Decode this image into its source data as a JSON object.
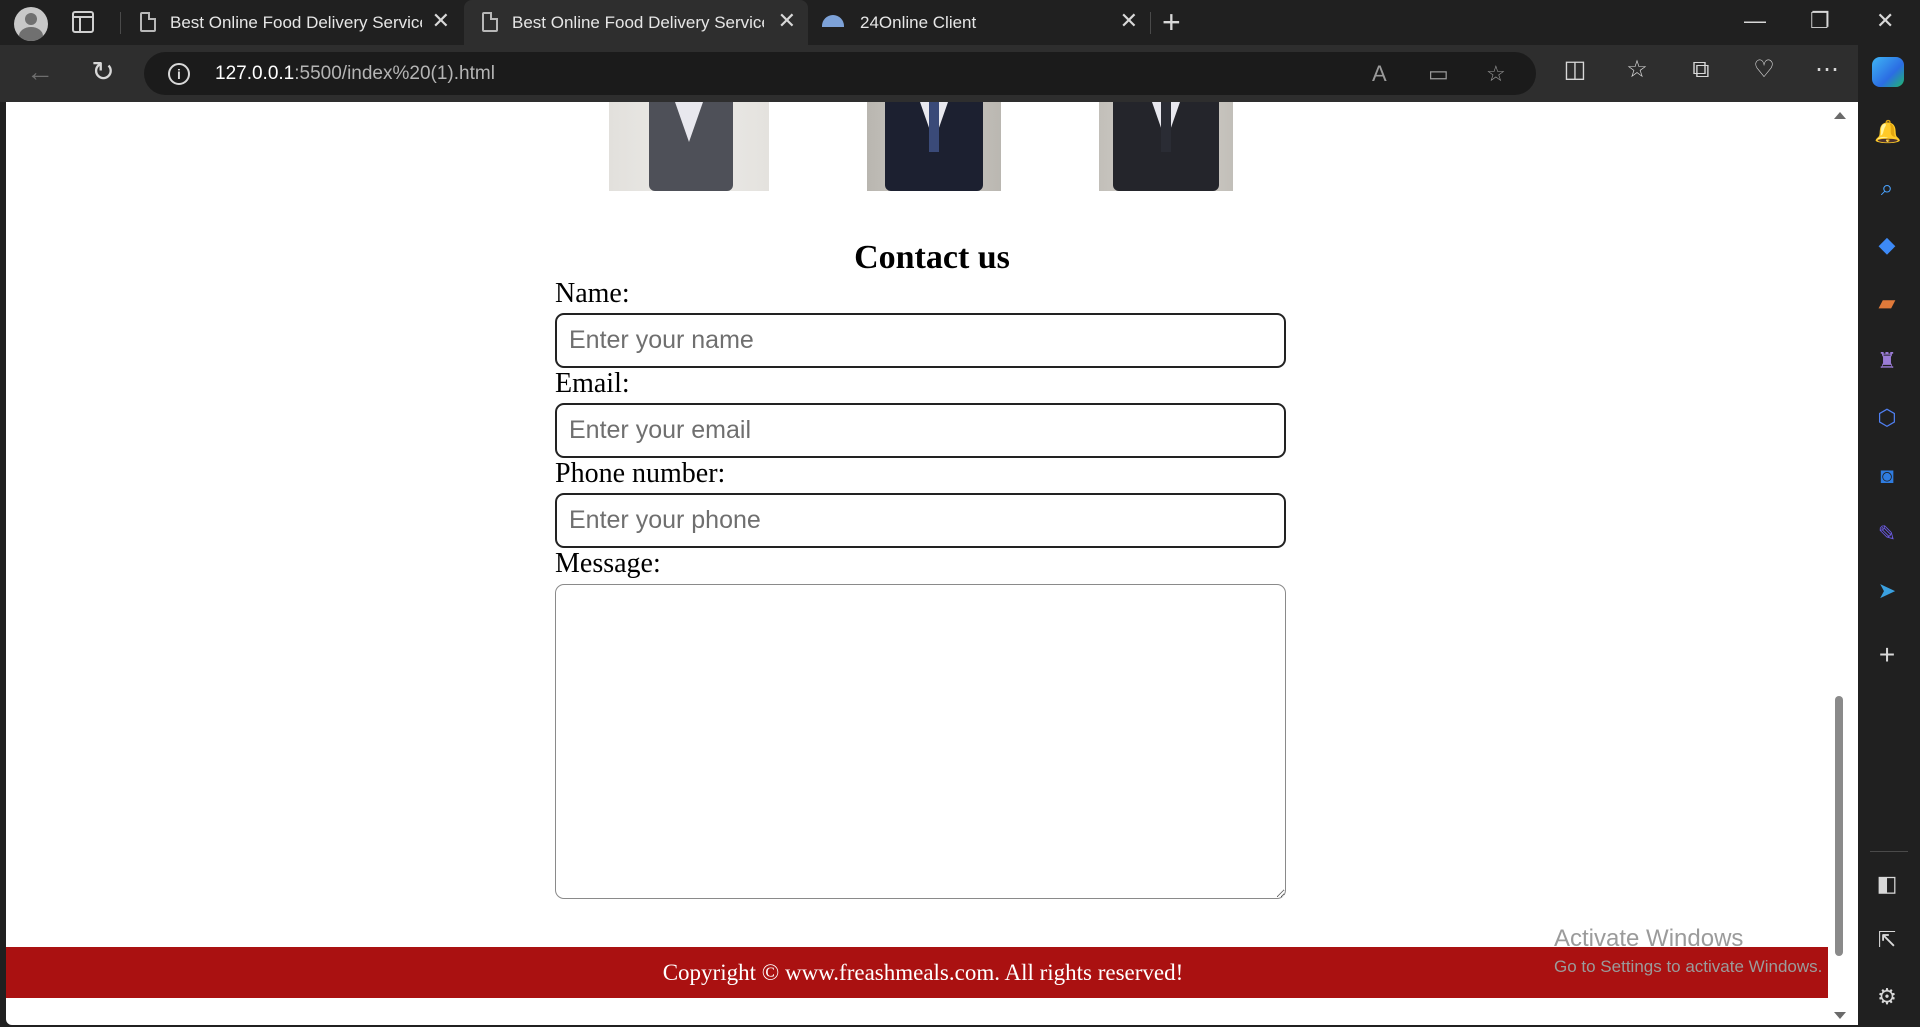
{
  "tabs": [
    {
      "title": "Best Online Food Delivery Service",
      "active": false
    },
    {
      "title": "Best Online Food Delivery Service",
      "active": true
    },
    {
      "title": "24Online Client",
      "active": false
    }
  ],
  "address": {
    "host": "127.0.0.1",
    "path": ":5500/index%20(1).html"
  },
  "page": {
    "contact": {
      "title": "Contact us",
      "fields": {
        "name_label": "Name:",
        "name_placeholder": "Enter your name",
        "email_label": "Email:",
        "email_placeholder": "Enter your email",
        "phone_label": "Phone number:",
        "phone_placeholder": "Enter your phone",
        "message_label": "Message:"
      }
    },
    "footer": {
      "text": "Copyright © www.freashmeals.com. All rights reserved!",
      "color": "#aa1111"
    }
  },
  "watermark": {
    "line1": "Activate Windows",
    "line2": "Go to Settings to activate Windows."
  }
}
